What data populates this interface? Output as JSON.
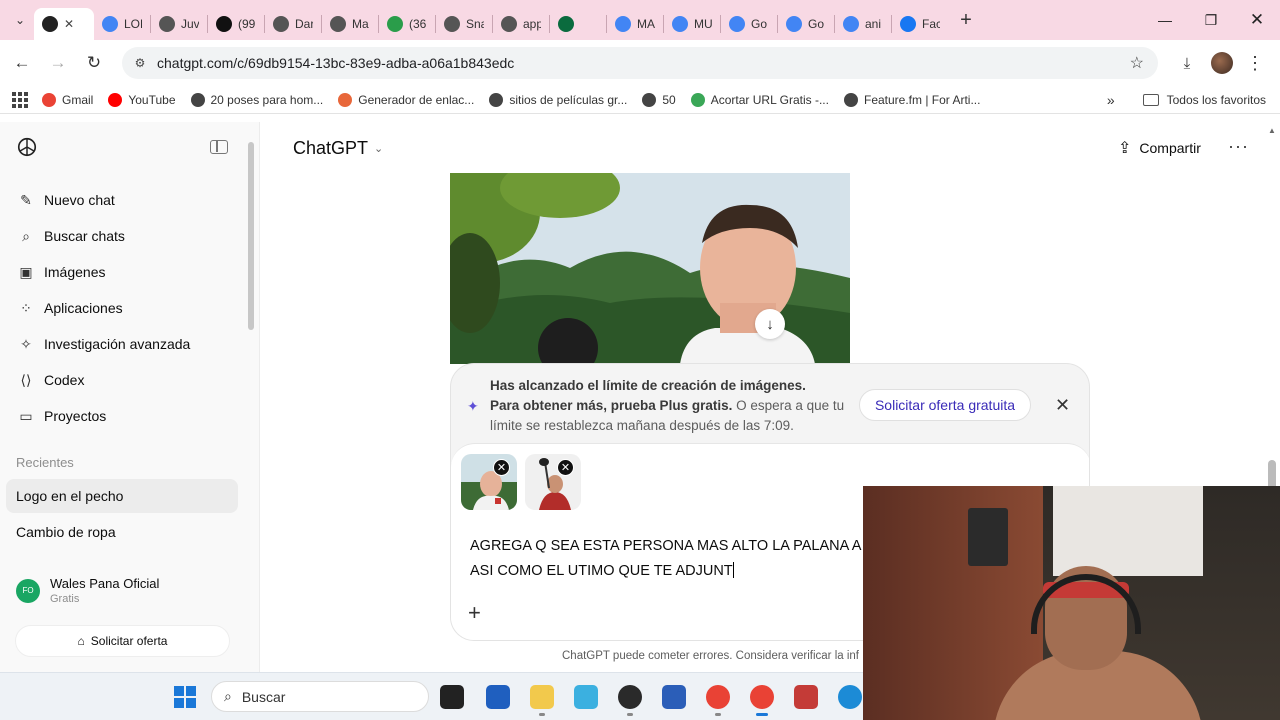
{
  "browser": {
    "tabs": [
      {
        "label": "",
        "icon": "chatgpt-icon",
        "color": "#222222",
        "active": true
      },
      {
        "label": "LOL",
        "icon": "google-icon",
        "color": "#4285f4"
      },
      {
        "label": "Juv",
        "icon": "globe-icon",
        "color": "#555555"
      },
      {
        "label": "(99",
        "icon": "tiktok-icon",
        "color": "#111111"
      },
      {
        "label": "Dar",
        "icon": "globe-icon",
        "color": "#555555"
      },
      {
        "label": "Ma",
        "icon": "globe-icon",
        "color": "#555555"
      },
      {
        "label": "(36",
        "icon": "badge-36-icon",
        "color": "#2a9d4a"
      },
      {
        "label": "Sna",
        "icon": "cloud-icon",
        "color": "#555555"
      },
      {
        "label": "app",
        "icon": "globe-icon",
        "color": "#555555"
      },
      {
        "label": "",
        "icon": "alien-icon",
        "color": "#0a6b3e"
      },
      {
        "label": "MA",
        "icon": "gmail-icon",
        "color": "#4285f4"
      },
      {
        "label": "MU",
        "icon": "gmail-icon",
        "color": "#4285f4"
      },
      {
        "label": "Go",
        "icon": "google-icon",
        "color": "#4285f4"
      },
      {
        "label": "Go",
        "icon": "google-icon",
        "color": "#4285f4"
      },
      {
        "label": "ani",
        "icon": "google-icon",
        "color": "#4285f4"
      },
      {
        "label": "Fac",
        "icon": "facebook-icon",
        "color": "#1877f2"
      }
    ],
    "url": "chatgpt.com/c/69db9154-13bc-83e9-adba-a06a1b843edc",
    "bookmarks": [
      {
        "label": "Gmail",
        "color": "#ea4335"
      },
      {
        "label": "YouTube",
        "color": "#ff0000"
      },
      {
        "label": "20 poses para hom...",
        "color": "#444444"
      },
      {
        "label": "Generador de enlac...",
        "color": "#e8673a"
      },
      {
        "label": "sitios de películas gr...",
        "color": "#444444"
      },
      {
        "label": "50",
        "color": "#444444"
      },
      {
        "label": "Acortar URL Gratis -...",
        "color": "#3aa757"
      },
      {
        "label": "Feature.fm | For Arti...",
        "color": "#444444"
      }
    ],
    "all_bookmarks": "Todos los favoritos"
  },
  "sidebar": {
    "items": [
      {
        "label": "Nuevo chat",
        "icon": "✎"
      },
      {
        "label": "Buscar chats",
        "icon": "⌕"
      },
      {
        "label": "Imágenes",
        "icon": "▣"
      },
      {
        "label": "Aplicaciones",
        "icon": "⁘"
      },
      {
        "label": "Investigación avanzada",
        "icon": "✧"
      },
      {
        "label": "Codex",
        "icon": "⟨⟩"
      },
      {
        "label": "Proyectos",
        "icon": "▭"
      }
    ],
    "recent_title": "Recientes",
    "recents": [
      "Logo en el pecho",
      "Cambio de ropa"
    ],
    "user": {
      "initials": "FO",
      "name": "Wales Pana Oficial",
      "plan": "Gratis"
    },
    "offer_button": "Solicitar oferta"
  },
  "header": {
    "title": "ChatGPT",
    "share": "Compartir"
  },
  "notice": {
    "line1": "Has alcanzado el límite de creación de imágenes.",
    "bold": "Para obtener más, prueba Plus gratis.",
    "rest": " O espera a que tu límite se restablezca mañana después de las 7:09.",
    "button": "Solicitar oferta gratuita"
  },
  "composer": {
    "line1": "AGREGA Q SEA ESTA PERSONA MAS ALTO LA PALANA A",
    "line2": "ASI COMO EL UTIMO QUE TE ADJUNT"
  },
  "disclaimer": "ChatGPT puede cometer errores. Considera verificar la inf",
  "taskbar": {
    "search_placeholder": "Buscar"
  },
  "colors": {
    "accent": "#3a2bb8",
    "tabstrip": "#f8d9e4"
  }
}
